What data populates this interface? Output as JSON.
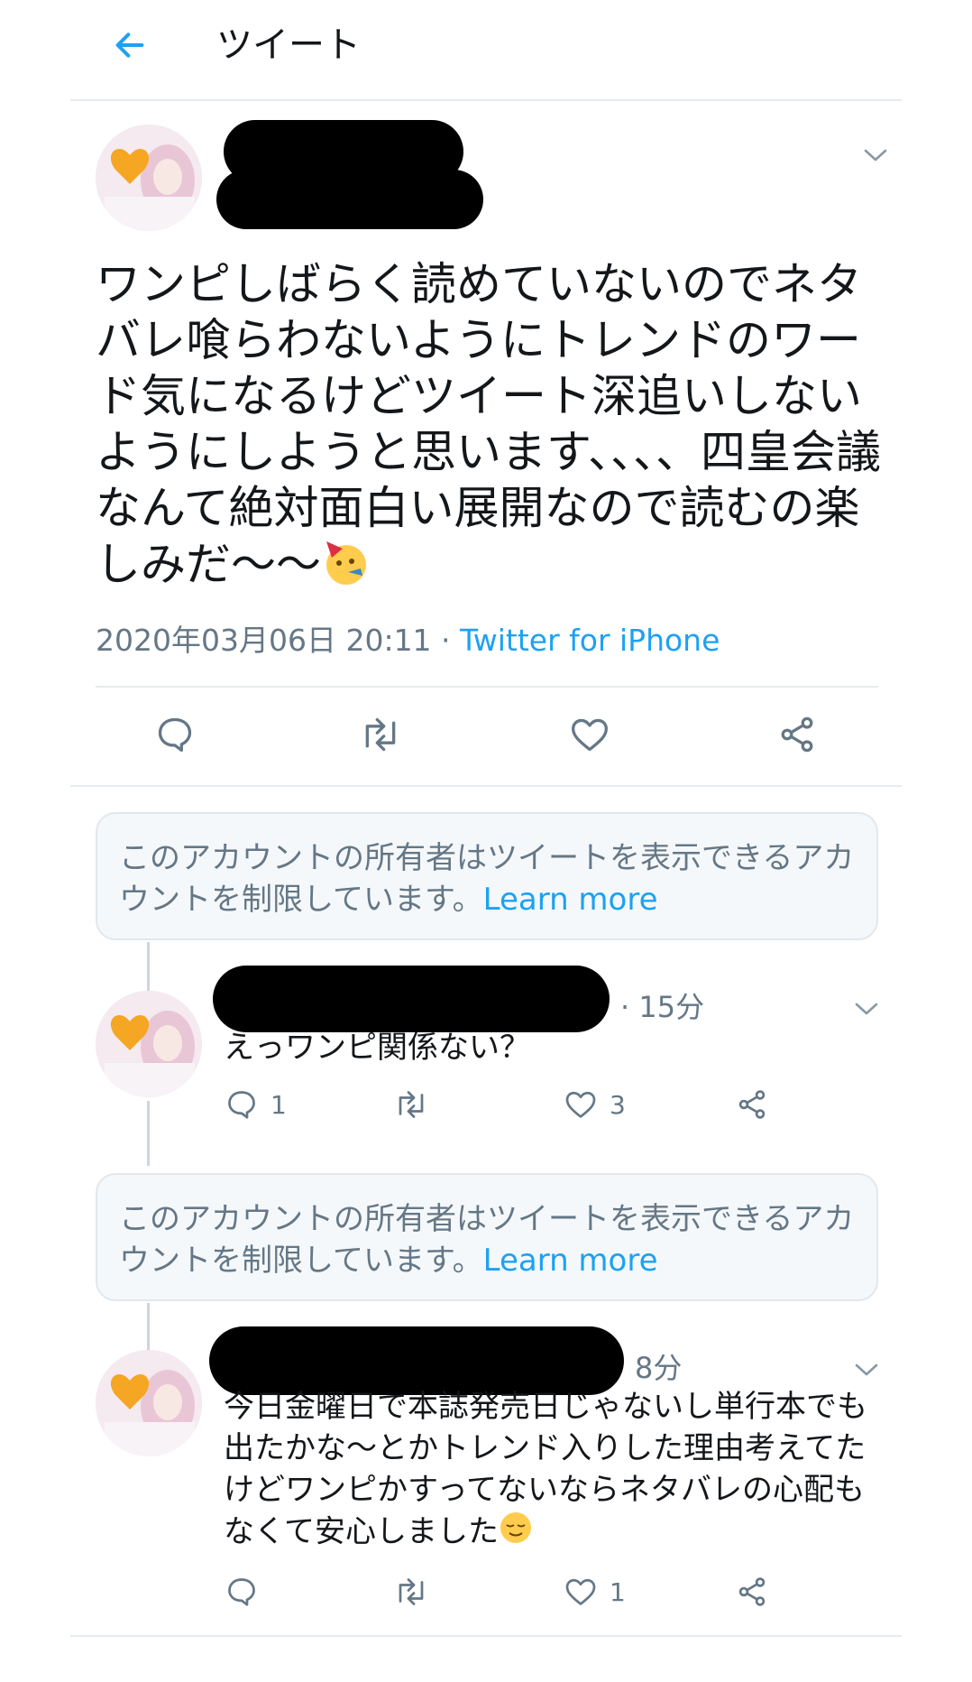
{
  "header": {
    "title": "ツイート"
  },
  "tweet": {
    "text": "ワンピしばらく読めていないのでネタバレ喰らわないようにトレンドのワード気になるけどツイート深追いしないようにしようと思います、、、、四皇会議なんて絶対面白い展開なので読むの楽しみだ〜〜",
    "emoji": "partying-face",
    "datetime": "2020年03月06日 20:11",
    "separator": " · ",
    "source": "Twitter for iPhone"
  },
  "notice": {
    "text": "このアカウントの所有者はツイートを表示できるアカウントを制限しています。",
    "learn_more": "Learn more"
  },
  "replies": [
    {
      "time": "· 15分",
      "text": "えっワンピ関係ない？",
      "reply_count": "1",
      "retweet_count": "",
      "like_count": "3"
    },
    {
      "time": "8分",
      "text": "今日金曜日で本誌発売日じゃないし単行本でも出たかな〜とかトレンド入りした理由考えてたけどワンピかすってないならネタバレの心配もなくて安心しました",
      "emoji": "relieved-face",
      "reply_count": "",
      "retweet_count": "",
      "like_count": "1"
    }
  ],
  "colors": {
    "accent": "#1da1f2",
    "secondary_text": "#657786",
    "border": "#e6ecf0"
  }
}
